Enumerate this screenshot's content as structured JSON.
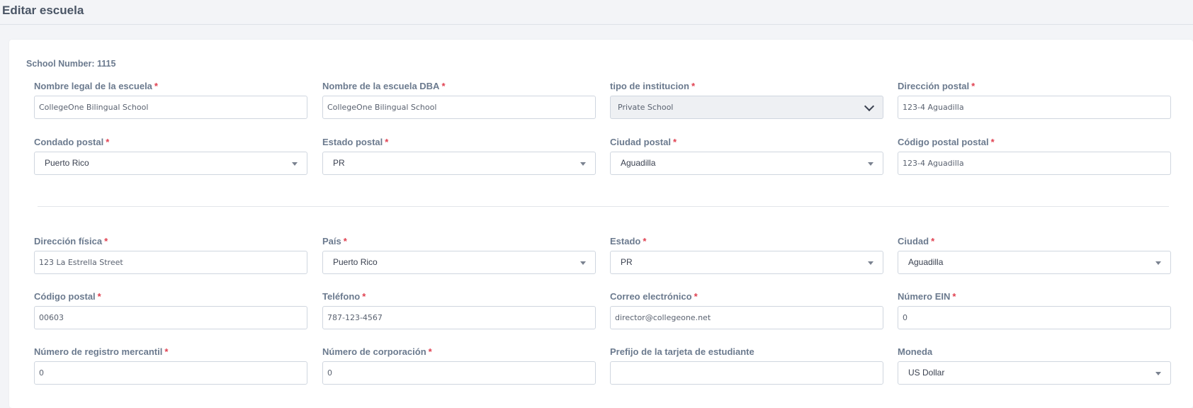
{
  "page": {
    "title": "Editar escuela"
  },
  "school_number": "School Number: 1115",
  "colors": {
    "required": "#e04050",
    "label": "#6b7a8e",
    "border": "#cfd6df"
  },
  "required_mark": "*",
  "fields": {
    "legal_name": {
      "label": "Nombre legal de la escuela",
      "value": "CollegeOne Bilingual School"
    },
    "dba_name": {
      "label": "Nombre de la escuela DBA",
      "value": "CollegeOne Bilingual School"
    },
    "institution_type": {
      "label": "tipo de institucion",
      "value": "Private School"
    },
    "postal_address": {
      "label": "Dirección postal",
      "value": "123-4 Aguadilla"
    },
    "postal_county": {
      "label": "Condado postal",
      "value": "Puerto Rico"
    },
    "postal_state": {
      "label": "Estado postal",
      "value": "PR"
    },
    "postal_city": {
      "label": "Ciudad postal",
      "value": "Aguadilla"
    },
    "postal_zip": {
      "label": "Código postal postal",
      "value": "123-4 Aguadilla"
    },
    "physical_address": {
      "label": "Dirección física",
      "value": "123 La Estrella Street"
    },
    "country": {
      "label": "País",
      "value": "Puerto Rico"
    },
    "state": {
      "label": "Estado",
      "value": "PR"
    },
    "city": {
      "label": "Ciudad",
      "value": "Aguadilla"
    },
    "zip": {
      "label": "Código postal",
      "value": "00603"
    },
    "phone": {
      "label": "Teléfono",
      "value": "787-123-4567"
    },
    "email": {
      "label": "Correo electrónico",
      "value": "director@collegeone.net"
    },
    "ein": {
      "label": "Número EIN",
      "value": "0"
    },
    "merchant_registry": {
      "label": "Número de registro mercantil",
      "value": "0"
    },
    "corporation_number": {
      "label": "Número de corporación",
      "value": "0"
    },
    "student_card_prefix": {
      "label": "Prefijo de la tarjeta de estudiante",
      "value": ""
    },
    "currency": {
      "label": "Moneda",
      "value": "US Dollar"
    }
  }
}
